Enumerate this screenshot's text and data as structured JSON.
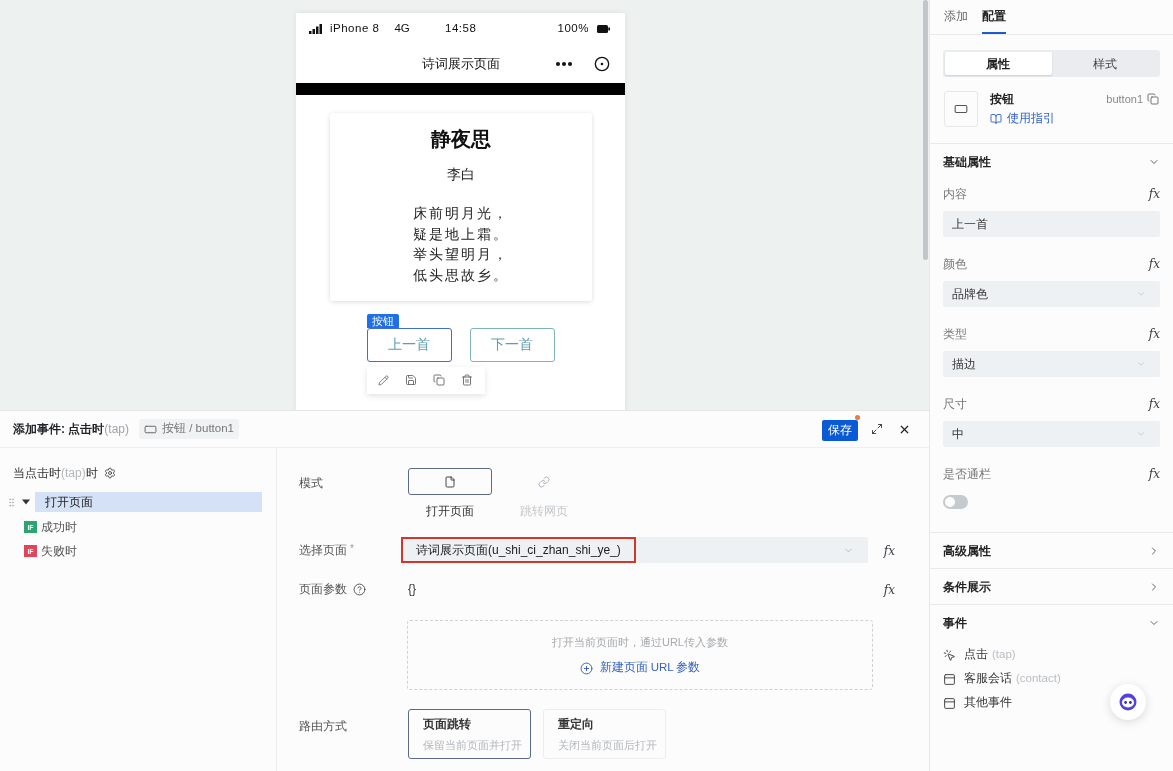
{
  "phone": {
    "status_bar": {
      "carrier": "iPhone 8",
      "network": "4G",
      "time": "14:58",
      "battery": "100%"
    },
    "nav_title": "诗词展示页面",
    "poem": {
      "title": "静夜思",
      "author": "李白",
      "lines": [
        "床前明月光，",
        "疑是地上霜。",
        "举头望明月，",
        "低头思故乡。"
      ]
    },
    "selection_tag": "按钮",
    "buttons": [
      {
        "label": "上一首",
        "selected": true
      },
      {
        "label": "下一首",
        "selected": false
      }
    ]
  },
  "event_dialog": {
    "title": "添加事件: 点击时",
    "title_hint": "(tap)",
    "target": "按钮 / button1",
    "save": "保存",
    "unsaved": true,
    "trigger": {
      "label": "当点击时",
      "hint": "(tap)",
      "suffix": "时"
    },
    "actions": [
      {
        "label": "打开页面",
        "selected": true,
        "expanded": true,
        "children": [
          {
            "badge": "IF",
            "label": "成功时",
            "color": "#2ba471"
          },
          {
            "badge": "IF",
            "label": "失败时",
            "color": "#e0455b"
          }
        ]
      }
    ],
    "form": {
      "mode": {
        "label": "模式",
        "options": [
          {
            "kind": "page",
            "label": "打开页面",
            "selected": true
          },
          {
            "kind": "link",
            "label": "跳转网页",
            "selected": false
          }
        ]
      },
      "page": {
        "label": "选择页面",
        "required_mark": "*",
        "value": "诗词展示页面(u_shi_ci_zhan_shi_ye_)",
        "annotated": true,
        "formula": "fx"
      },
      "params": {
        "label": "页面参数",
        "value": "{}",
        "formula": "fx",
        "hint": "打开当前页面时，通过URL传入参数",
        "add": "新建页面 URL 参数"
      },
      "route": {
        "label": "路由方式",
        "options": [
          {
            "title": "页面跳转",
            "desc": "保留当前页面并打开",
            "selected": true
          },
          {
            "title": "重定向",
            "desc": "关闭当前页面后打开",
            "selected": false
          }
        ]
      }
    }
  },
  "right_panel": {
    "tabs": [
      {
        "label": "添加",
        "selected": false
      },
      {
        "label": "配置",
        "selected": true
      }
    ],
    "segments": [
      {
        "label": "属性",
        "selected": true
      },
      {
        "label": "样式",
        "selected": false
      }
    ],
    "component": {
      "name": "按钮",
      "guide": "使用指引",
      "id": "button1"
    },
    "sections": [
      {
        "title": "基础属性",
        "expanded": true,
        "fields": [
          {
            "kind": "input",
            "label": "内容",
            "formula": "fx",
            "value": "上一首"
          },
          {
            "kind": "select",
            "label": "颜色",
            "formula": "fx",
            "value": "品牌色"
          },
          {
            "kind": "select",
            "label": "类型",
            "formula": "fx",
            "value": "描边"
          },
          {
            "kind": "select",
            "label": "尺寸",
            "formula": "fx",
            "value": "中"
          },
          {
            "kind": "switch",
            "label": "是否通栏",
            "formula": "fx",
            "on": false
          }
        ]
      },
      {
        "title": "高级属性",
        "expanded": false
      },
      {
        "title": "条件展示",
        "expanded": false
      },
      {
        "title": "事件",
        "expanded": true,
        "events": [
          {
            "kind": "tap",
            "label": "点击",
            "hint": "(tap)"
          },
          {
            "kind": "window",
            "label": "客服会话",
            "hint": "(contact)"
          },
          {
            "kind": "window",
            "label": "其他事件"
          }
        ]
      }
    ]
  }
}
